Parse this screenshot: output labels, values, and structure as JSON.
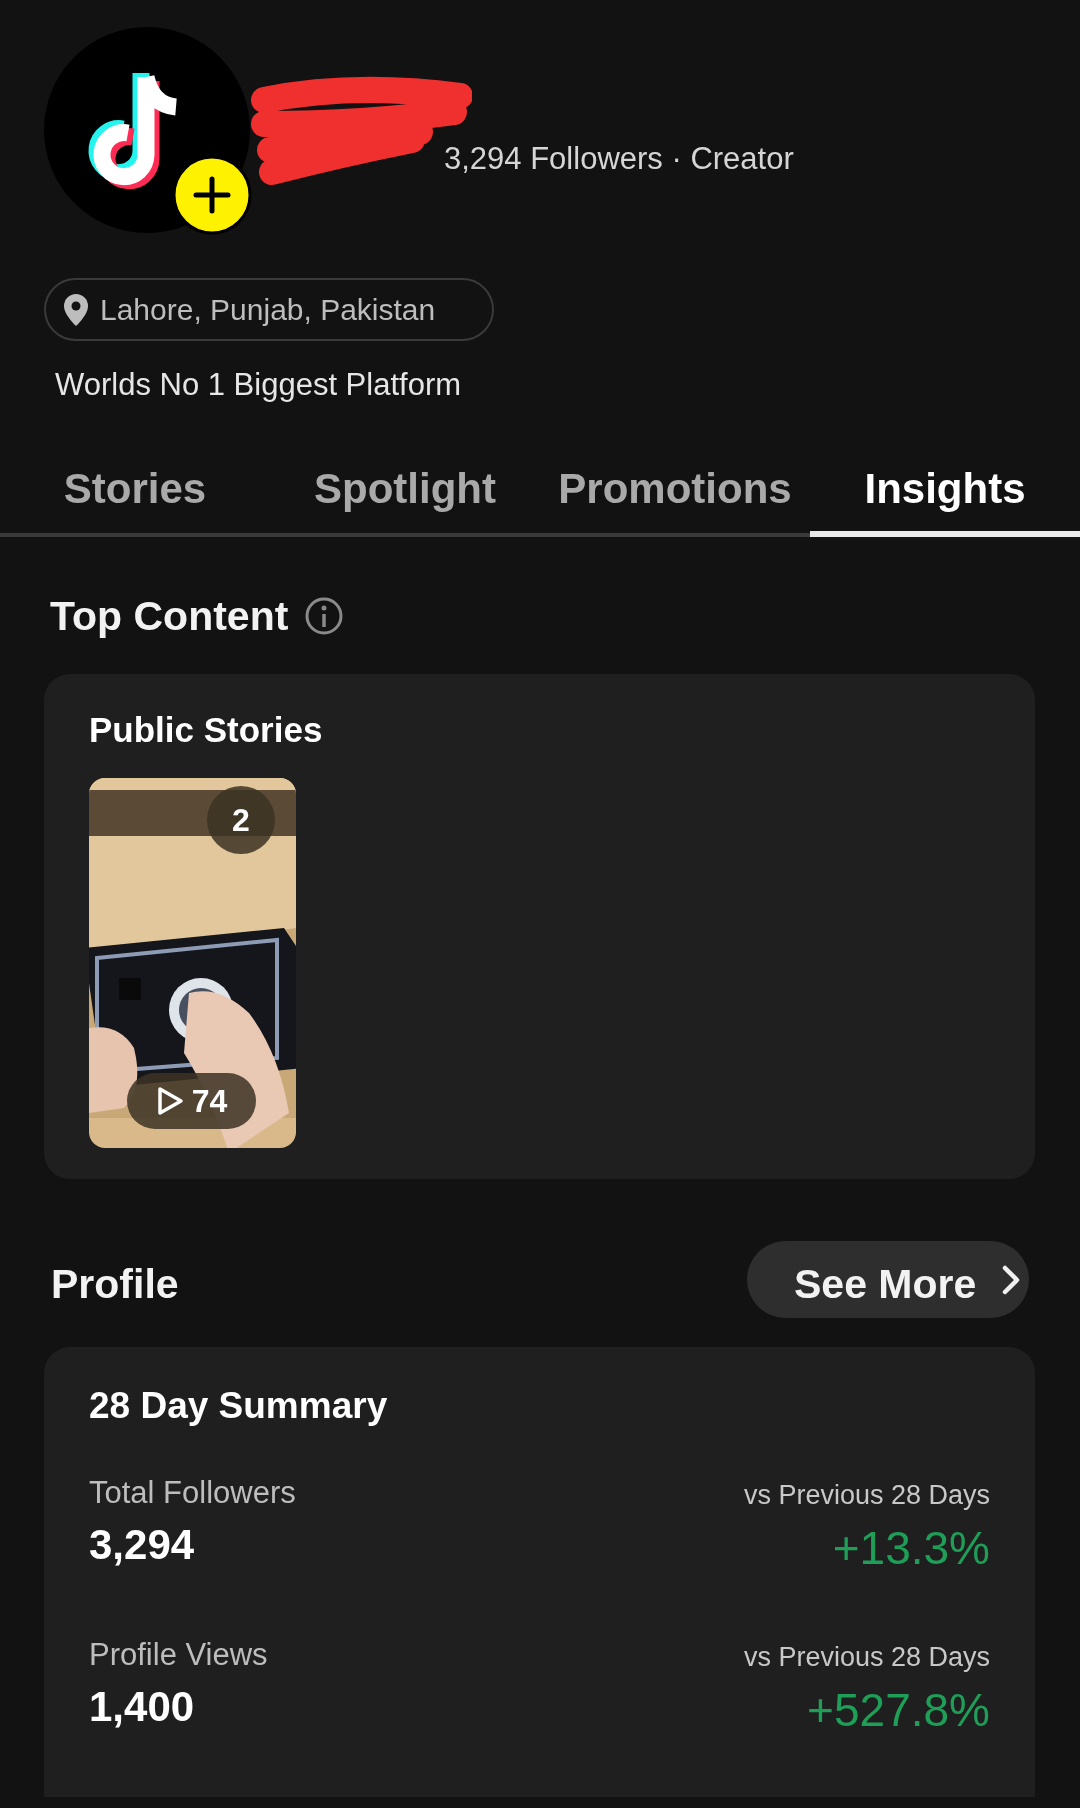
{
  "profile": {
    "stats": "3,294 Followers · Creator",
    "location": "Lahore, Punjab, Pakistan",
    "bio": "Worlds No 1 Biggest Platform"
  },
  "tabs": [
    {
      "label": "Stories",
      "selected": false
    },
    {
      "label": "Spotlight",
      "selected": false
    },
    {
      "label": "Promotions",
      "selected": false
    },
    {
      "label": "Insights",
      "selected": true
    }
  ],
  "top_content": {
    "title": "Top Content",
    "section": "Public Stories",
    "stories": [
      {
        "kind": "picture",
        "count": "2",
        "views": "74"
      }
    ]
  },
  "profile_section": {
    "title": "Profile",
    "button": "See More"
  },
  "summary": {
    "title": "28 Day Summary",
    "metrics": [
      {
        "label": "Total Followers",
        "value": "3,294",
        "comparison": "vs Previous 28 Days",
        "change": "+13.3%"
      },
      {
        "label": "Profile Views",
        "value": "1,400",
        "comparison": "vs Previous 28 Days",
        "change": "+527.8%"
      }
    ]
  }
}
